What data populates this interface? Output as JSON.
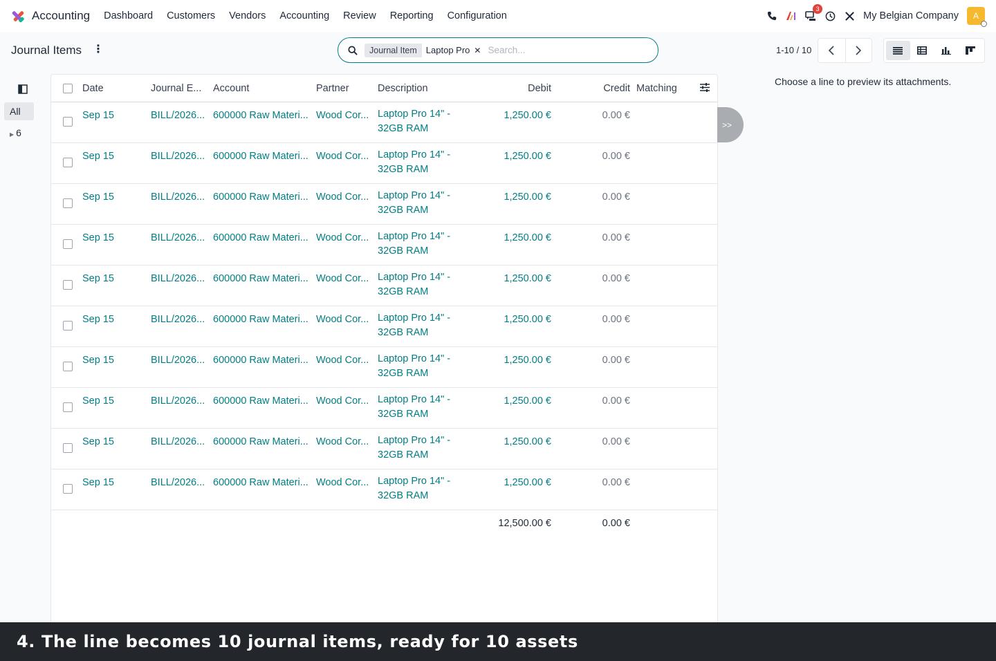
{
  "app": {
    "name": "Accounting",
    "company": "My Belgian Company",
    "avatar_letter": "A",
    "chat_badge": "3",
    "accent_color": "#017e84"
  },
  "nav": [
    "Dashboard",
    "Customers",
    "Vendors",
    "Accounting",
    "Review",
    "Reporting",
    "Configuration"
  ],
  "control": {
    "title": "Journal Items",
    "facet_type": "Journal Item",
    "facet_value": "Laptop Pro",
    "search_placeholder": "Search...",
    "pager": "1-10 / 10"
  },
  "side": {
    "all": "All",
    "group": "6"
  },
  "columns": {
    "date": "Date",
    "journal_entry": "Journal E...",
    "account": "Account",
    "partner": "Partner",
    "description": "Description",
    "debit": "Debit",
    "credit": "Credit",
    "matching": "Matching"
  },
  "rows": [
    {
      "date": "Sep 15",
      "entry": "BILL/2026...",
      "account": "600000 Raw Materi...",
      "partner": "Wood Cor...",
      "description": "Laptop Pro 14\" - 32GB RAM",
      "debit": "1,250.00 €",
      "credit": "0.00 €"
    },
    {
      "date": "Sep 15",
      "entry": "BILL/2026...",
      "account": "600000 Raw Materi...",
      "partner": "Wood Cor...",
      "description": "Laptop Pro 14\" - 32GB RAM",
      "debit": "1,250.00 €",
      "credit": "0.00 €"
    },
    {
      "date": "Sep 15",
      "entry": "BILL/2026...",
      "account": "600000 Raw Materi...",
      "partner": "Wood Cor...",
      "description": "Laptop Pro 14\" - 32GB RAM",
      "debit": "1,250.00 €",
      "credit": "0.00 €"
    },
    {
      "date": "Sep 15",
      "entry": "BILL/2026...",
      "account": "600000 Raw Materi...",
      "partner": "Wood Cor...",
      "description": "Laptop Pro 14\" - 32GB RAM",
      "debit": "1,250.00 €",
      "credit": "0.00 €"
    },
    {
      "date": "Sep 15",
      "entry": "BILL/2026...",
      "account": "600000 Raw Materi...",
      "partner": "Wood Cor...",
      "description": "Laptop Pro 14\" - 32GB RAM",
      "debit": "1,250.00 €",
      "credit": "0.00 €"
    },
    {
      "date": "Sep 15",
      "entry": "BILL/2026...",
      "account": "600000 Raw Materi...",
      "partner": "Wood Cor...",
      "description": "Laptop Pro 14\" - 32GB RAM",
      "debit": "1,250.00 €",
      "credit": "0.00 €"
    },
    {
      "date": "Sep 15",
      "entry": "BILL/2026...",
      "account": "600000 Raw Materi...",
      "partner": "Wood Cor...",
      "description": "Laptop Pro 14\" - 32GB RAM",
      "debit": "1,250.00 €",
      "credit": "0.00 €"
    },
    {
      "date": "Sep 15",
      "entry": "BILL/2026...",
      "account": "600000 Raw Materi...",
      "partner": "Wood Cor...",
      "description": "Laptop Pro 14\" - 32GB RAM",
      "debit": "1,250.00 €",
      "credit": "0.00 €"
    },
    {
      "date": "Sep 15",
      "entry": "BILL/2026...",
      "account": "600000 Raw Materi...",
      "partner": "Wood Cor...",
      "description": "Laptop Pro 14\" - 32GB RAM",
      "debit": "1,250.00 €",
      "credit": "0.00 €"
    },
    {
      "date": "Sep 15",
      "entry": "BILL/2026...",
      "account": "600000 Raw Materi...",
      "partner": "Wood Cor...",
      "description": "Laptop Pro 14\" - 32GB RAM",
      "debit": "1,250.00 €",
      "credit": "0.00 €"
    }
  ],
  "totals": {
    "debit": "12,500.00 €",
    "credit": "0.00 €"
  },
  "preview": {
    "expand_label": ">>",
    "message": "Choose a line to preview its attachments."
  },
  "caption": "4. The line becomes 10 journal items, ready for 10 assets"
}
